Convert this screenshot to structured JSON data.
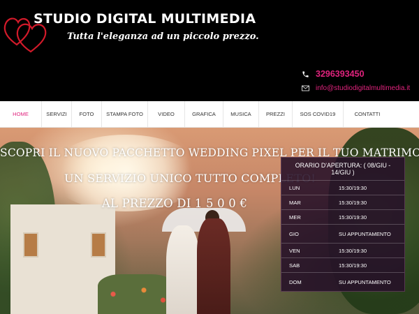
{
  "header": {
    "brand": "STUDIO DIGITAL MULTIMEDIA",
    "tagline": "Tutta l'eleganza ad un piccolo prezzo.",
    "phone": "3296393450",
    "email": "info@studiodigitalmultimedia.it",
    "accent_color": "#e0237d",
    "icons": [
      "hearts-logo-icon",
      "phone-icon",
      "mail-icon"
    ]
  },
  "nav": {
    "items": [
      {
        "label": "HOME",
        "active": true
      },
      {
        "label": "SERVIZI",
        "active": false
      },
      {
        "label": "FOTO",
        "active": false
      },
      {
        "label": "STAMPA FOTO",
        "active": false
      },
      {
        "label": "VIDEO",
        "active": false
      },
      {
        "label": "GRAFICA",
        "active": false
      },
      {
        "label": "MUSICA",
        "active": false
      },
      {
        "label": "PREZZI",
        "active": false
      },
      {
        "label": "SOS COVID19",
        "active": false
      },
      {
        "label": "CONTATTI",
        "active": false
      }
    ]
  },
  "hero": {
    "line1": "SCOPRI IL NUOVO PACCHETTO WEDDING PIXEL PER IL TUO MATRIMONIO",
    "line2": "UN  SERVIZIO UNICO TUTTO COMPLETO!",
    "line3": "AL PREZZO DI 1 5 0 0 €"
  },
  "hours": {
    "title": "ORARIO D'APERTURA: ( 08/GIU - 14/GIU )",
    "rows": [
      {
        "day": "LUN",
        "time": "15:30/19:30"
      },
      {
        "day": "MAR",
        "time": "15:30/19:30"
      },
      {
        "day": "MER",
        "time": "15:30/19:30"
      },
      {
        "day": "GIO",
        "time": "SU APPUNTAMENTO"
      },
      {
        "day": "VEN",
        "time": "15:30/19:30"
      },
      {
        "day": "SAB",
        "time": "15:30/19:30"
      },
      {
        "day": "DOM",
        "time": "SU APPUNTAMENTO"
      }
    ]
  }
}
